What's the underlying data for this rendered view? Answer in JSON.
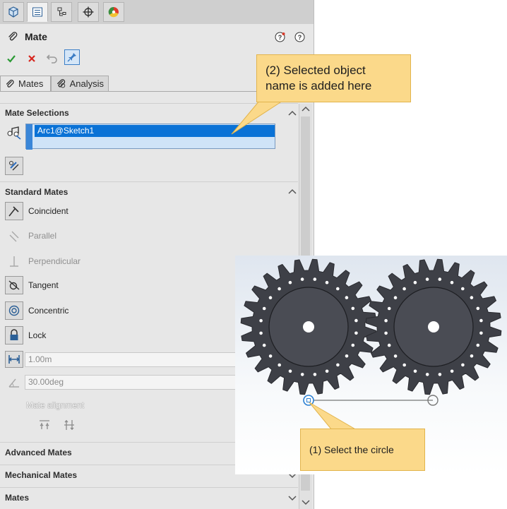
{
  "toolbar": {
    "tabs": [
      {
        "name": "feature-manager-tab",
        "icon": "cube-icon"
      },
      {
        "name": "property-manager-tab",
        "icon": "property-manager-icon"
      },
      {
        "name": "configuration-manager-tab",
        "icon": "configuration-icon"
      },
      {
        "name": "dimxpert-tab",
        "icon": "crosshair-icon"
      },
      {
        "name": "display-manager-tab",
        "icon": "color-wheel-icon"
      }
    ]
  },
  "header": {
    "title": "Mate",
    "icons": [
      "paperclip-icon",
      "help-icon",
      "question-icon"
    ],
    "actions": [
      "ok-check-icon",
      "cancel-x-icon",
      "undo-icon",
      "pushpin-icon"
    ]
  },
  "tabs": [
    {
      "label": "Mates",
      "icon": "paperclip-icon",
      "active": true
    },
    {
      "label": "Analysis",
      "icon": "analysis-icon",
      "active": false
    }
  ],
  "mate_selections": {
    "title": "Mate Selections",
    "items": [
      "Arc1@Sketch1"
    ]
  },
  "standard_mates": {
    "title": "Standard Mates",
    "items": [
      {
        "label": "Coincident",
        "icon": "coincident-icon",
        "enabled": true
      },
      {
        "label": "Parallel",
        "icon": "parallel-icon",
        "enabled": false
      },
      {
        "label": "Perpendicular",
        "icon": "perpendicular-icon",
        "enabled": false
      },
      {
        "label": "Tangent",
        "icon": "tangent-icon",
        "enabled": true
      },
      {
        "label": "Concentric",
        "icon": "concentric-icon",
        "enabled": true
      },
      {
        "label": "Lock",
        "icon": "lock-icon",
        "enabled": true
      }
    ],
    "distance_value": "1.00m",
    "angle_value": "30.00deg",
    "alignment_label": "Mate alignment"
  },
  "collapsed_sections": [
    "Advanced Mates",
    "Mechanical Mates",
    "Mates"
  ],
  "callouts": {
    "top": "(2) Selected object\nname is added here",
    "bottom": "(1) Select the circle"
  },
  "colors": {
    "panel_bg": "#e7e7e7",
    "selection_blue": "#0a72d6",
    "callout_fill": "#fbd98a",
    "gear_fill": "#3e4047"
  }
}
